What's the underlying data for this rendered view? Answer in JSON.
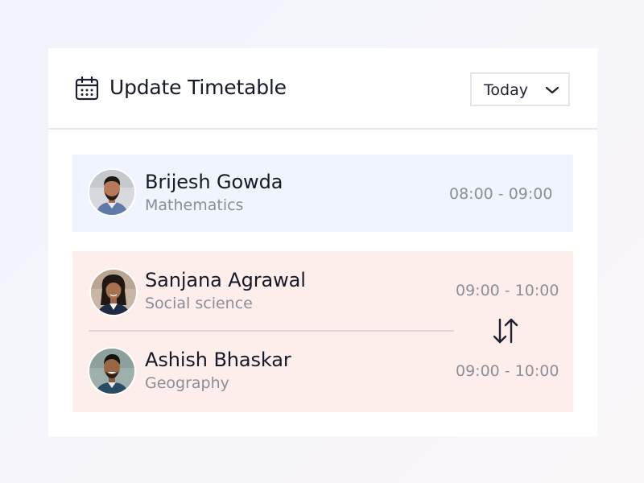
{
  "header": {
    "title": "Update Timetable",
    "icon": "calendar-icon",
    "filter": {
      "selected": "Today",
      "icon": "chevron-down-icon"
    }
  },
  "timetable": {
    "current": {
      "teacher": "Brijesh Gowda",
      "subject": "Mathematics",
      "time": "08:00 - 09:00"
    },
    "swap": {
      "icon": "swap-vertical-arrows-icon",
      "first": {
        "teacher": "Sanjana Agrawal",
        "subject": "Social science",
        "time": "09:00 - 10:00"
      },
      "second": {
        "teacher": "Ashish Bhaskar",
        "subject": "Geography",
        "time": "09:00 - 10:00"
      }
    }
  },
  "colors": {
    "title_text": "#161a2b",
    "muted_text": "#8b8d97",
    "current_row_bg": "#f0f4fe",
    "swap_group_bg": "#fdeeec",
    "card_bg": "#ffffff"
  }
}
